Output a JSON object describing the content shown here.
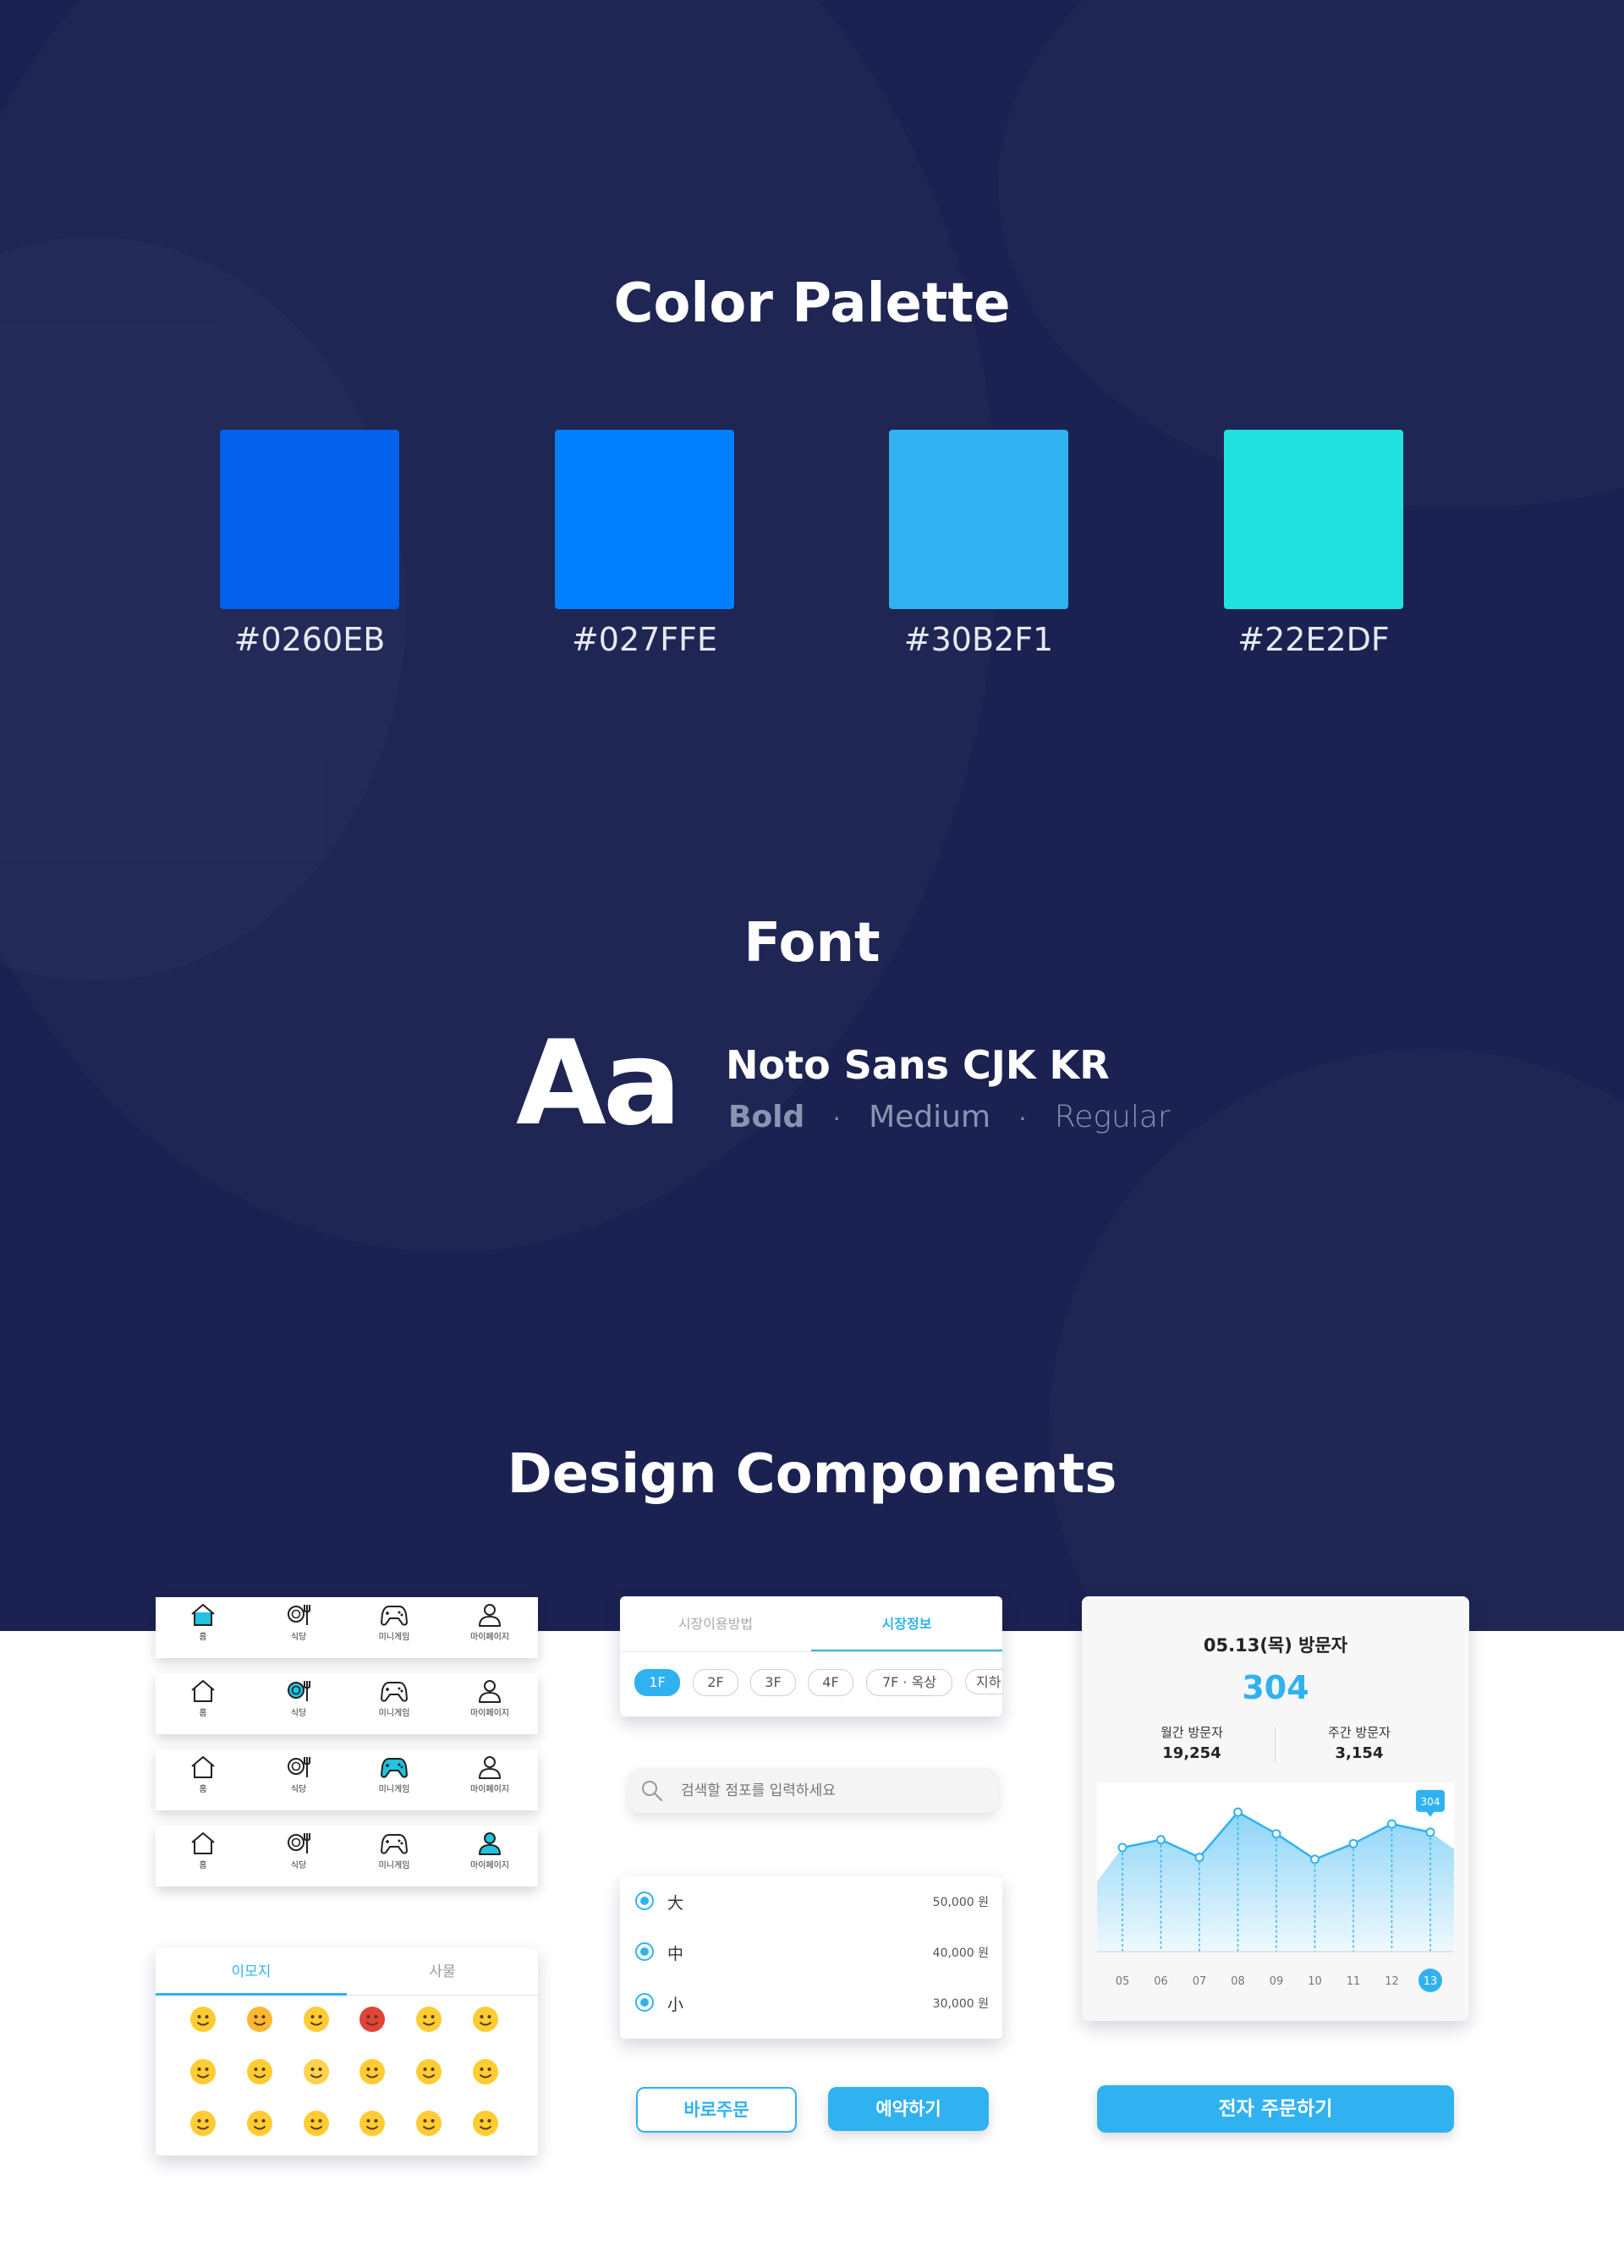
{
  "sections": {
    "color_palette": "Color Palette",
    "font": "Font",
    "design_components": "Design Components"
  },
  "palette": [
    {
      "hex": "#0260EB"
    },
    {
      "hex": "#027FFE"
    },
    {
      "hex": "#30B2F1"
    },
    {
      "hex": "#22E2DF"
    }
  ],
  "font_showcase": {
    "sample": "Aa",
    "family": "Noto Sans CJK KR",
    "weights": [
      "Bold",
      "Medium",
      "Regular"
    ],
    "separator": "·"
  },
  "nav": {
    "items": [
      "홈",
      "식당",
      "미니게임",
      "마이페이지"
    ],
    "active_color": "#22c2e0"
  },
  "emoji_card": {
    "tabs": [
      "이모지",
      "사물"
    ]
  },
  "market_tabs": {
    "tabs": [
      "시장이용방법",
      "시장정보"
    ],
    "floors": [
      "1F",
      "2F",
      "3F",
      "4F",
      "7F · 옥상",
      "지하"
    ]
  },
  "search": {
    "placeholder": "검색할 점포를 입력하세요"
  },
  "options": [
    {
      "label": "大",
      "price": "50,000 원"
    },
    {
      "label": "中",
      "price": "40,000 원"
    },
    {
      "label": "小",
      "price": "30,000 원"
    }
  ],
  "buttons": {
    "order_now": "바로주문",
    "reserve": "예약하기",
    "e_order": "전자 주문하기"
  },
  "visitors": {
    "title": "05.13(목) 방문자",
    "value": "304",
    "monthly_label": "월간 방문자",
    "monthly_value": "19,254",
    "weekly_label": "주간 방문자",
    "weekly_value": "3,154"
  },
  "chart_data": {
    "type": "area",
    "x": [
      "05",
      "06",
      "07",
      "08",
      "09",
      "10",
      "11",
      "12",
      "13"
    ],
    "values": [
      265,
      285,
      240,
      355,
      300,
      235,
      275,
      325,
      304
    ],
    "highlight": {
      "x": "13",
      "label": "304"
    },
    "ylim": [
      0,
      420
    ],
    "color": "#30b2f1"
  }
}
